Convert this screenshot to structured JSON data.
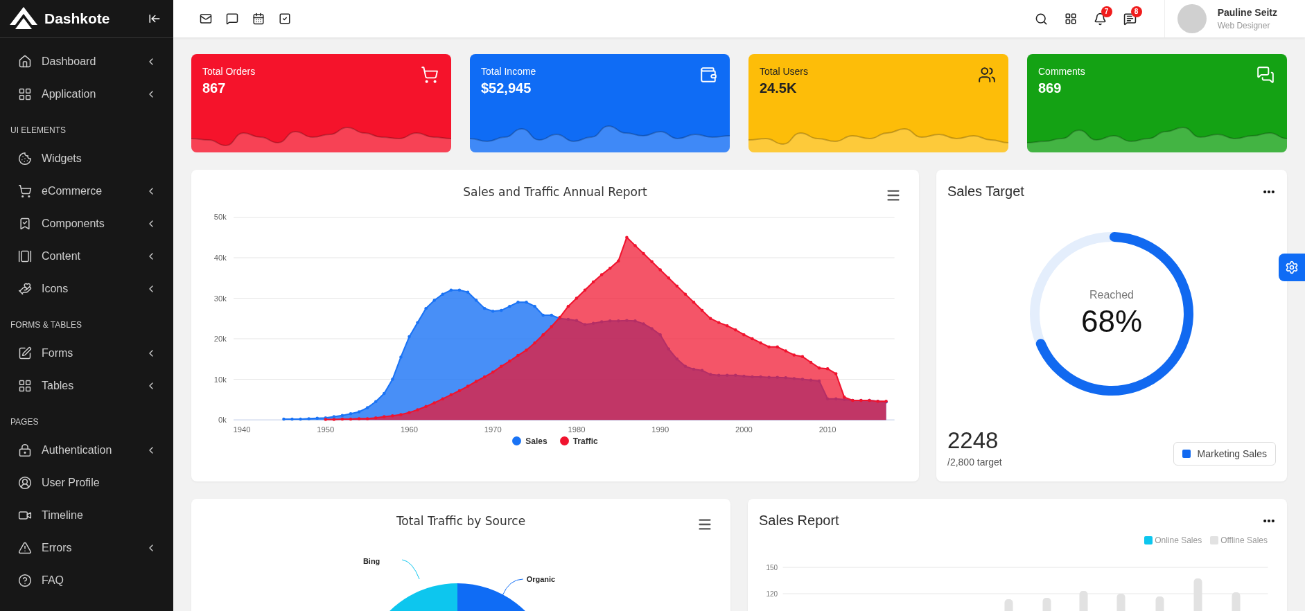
{
  "sidebar": {
    "brand": "Dashkote",
    "groups": [
      {
        "items": [
          {
            "label": "Dashboard",
            "has_submenu": true
          },
          {
            "label": "Application",
            "has_submenu": true
          }
        ]
      },
      {
        "heading": "UI ELEMENTS",
        "items": [
          {
            "label": "Widgets",
            "has_submenu": false
          },
          {
            "label": "eCommerce",
            "has_submenu": true
          },
          {
            "label": "Components",
            "has_submenu": true
          },
          {
            "label": "Content",
            "has_submenu": true
          },
          {
            "label": "Icons",
            "has_submenu": true
          }
        ]
      },
      {
        "heading": "FORMS & TABLES",
        "items": [
          {
            "label": "Forms",
            "has_submenu": true
          },
          {
            "label": "Tables",
            "has_submenu": true
          }
        ]
      },
      {
        "heading": "PAGES",
        "items": [
          {
            "label": "Authentication",
            "has_submenu": true
          },
          {
            "label": "User Profile",
            "has_submenu": false
          },
          {
            "label": "Timeline",
            "has_submenu": false
          },
          {
            "label": "Errors",
            "has_submenu": true
          },
          {
            "label": "FAQ",
            "has_submenu": false
          }
        ]
      }
    ]
  },
  "topbar": {
    "notification_count": "7",
    "message_count": "8",
    "user": {
      "name": "Pauline Seitz",
      "role": "Web Designer"
    }
  },
  "stats": [
    {
      "title": "Total Orders",
      "value": "867",
      "color": "#f5132b"
    },
    {
      "title": "Total Income",
      "value": "$52,945",
      "color": "#0f6cf5"
    },
    {
      "title": "Total Users",
      "value": "24.5K",
      "color": "#fdbd09"
    },
    {
      "title": "Comments",
      "value": "869",
      "color": "#14a214"
    }
  ],
  "annual_report": {
    "chart_data": {
      "type": "area",
      "title": "Sales and Traffic Annual Report",
      "x": [
        1945,
        1946,
        1947,
        1948,
        1949,
        1950,
        1951,
        1952,
        1953,
        1954,
        1955,
        1956,
        1957,
        1958,
        1959,
        1960,
        1961,
        1962,
        1963,
        1964,
        1965,
        1966,
        1967,
        1968,
        1969,
        1970,
        1971,
        1972,
        1973,
        1974,
        1975,
        1976,
        1977,
        1978,
        1979,
        1980,
        1981,
        1982,
        1983,
        1984,
        1985,
        1986,
        1987,
        1988,
        1989,
        1990,
        1991,
        1992,
        1993,
        1994,
        1995,
        1996,
        1997,
        1998,
        1999,
        2000,
        2001,
        2002,
        2003,
        2004,
        2005,
        2006,
        2007,
        2008,
        2009,
        2010,
        2011,
        2012,
        2013,
        2014,
        2015,
        2016,
        2017
      ],
      "series": [
        {
          "name": "Sales",
          "color": "#1a73f5",
          "values": [
            0.2,
            0.2,
            0.2,
            0.3,
            0.4,
            0.5,
            0.8,
            1.1,
            1.5,
            2,
            3,
            4.5,
            6.5,
            10,
            15.5,
            20.5,
            24,
            27.5,
            29.5,
            31,
            32,
            32,
            31.5,
            29.5,
            27.5,
            26.8,
            27,
            28,
            29,
            29,
            28,
            25.8,
            25.8,
            25,
            24.8,
            24.5,
            23.5,
            23.8,
            24.2,
            24.4,
            24.4,
            24.5,
            24.4,
            23.7,
            22.5,
            21,
            17.5,
            15,
            13.2,
            12.5,
            12.2,
            11.2,
            11,
            11,
            11,
            10.8,
            10.6,
            10.6,
            10.5,
            10.5,
            10.4,
            10.2,
            10,
            9.8,
            9.6,
            5.2,
            5.2,
            5,
            4.8,
            4.8,
            4.8,
            4.6,
            4.4
          ]
        },
        {
          "name": "Traffic",
          "color": "#f0132e",
          "values": [
            null,
            null,
            null,
            null,
            null,
            0.1,
            0.1,
            0.2,
            0.2,
            0.3,
            0.3,
            0.5,
            0.8,
            1,
            1.3,
            1.8,
            2.5,
            3.3,
            4.2,
            5.2,
            6.2,
            7.2,
            8.3,
            9.5,
            10.6,
            11.8,
            13.2,
            14.5,
            15.9,
            17.2,
            19,
            21,
            23,
            25.3,
            28,
            30,
            32,
            34,
            35.8,
            37.4,
            39.2,
            45,
            43,
            41,
            39,
            37,
            35,
            33,
            31,
            29,
            27,
            25,
            24,
            23.2,
            22.2,
            21,
            20,
            19,
            18,
            18,
            17,
            16,
            15.6,
            14.2,
            12.8,
            12.6,
            11.4,
            5.6,
            4.8,
            4.8,
            4.8,
            4.6,
            4.6
          ]
        }
      ],
      "grid": true,
      "xlim": [
        1939,
        2018
      ],
      "ylim": [
        0,
        50
      ],
      "xticks": [
        1940,
        1950,
        1960,
        1970,
        1980,
        1990,
        2000,
        2010
      ],
      "yticks": [
        {
          "value": 0,
          "label": "0k"
        },
        {
          "value": 10,
          "label": "10k"
        },
        {
          "value": 20,
          "label": "20k"
        },
        {
          "value": 30,
          "label": "30k"
        },
        {
          "value": 40,
          "label": "40k"
        },
        {
          "value": 50,
          "label": "50k"
        }
      ]
    }
  },
  "sales_target": {
    "title": "Sales Target",
    "center_label": "Reached",
    "center_value": "68%",
    "level": 0.68,
    "total": "2248",
    "target": "/2,800 target",
    "legend": "Marketing Sales"
  },
  "traffic_source": {
    "title": "Total Traffic by Source",
    "segments": [
      {
        "label": "Bing",
        "color": "#0dc6ee"
      },
      {
        "label": "Organic",
        "color": "#0f6cf5"
      }
    ]
  },
  "sales_report": {
    "title": "Sales Report",
    "legend": [
      {
        "label": "Online Sales",
        "color": "#0dc6ee"
      },
      {
        "label": "Offline Sales",
        "color": "#e2e2e2"
      }
    ],
    "y_labels": [
      "150",
      "120"
    ]
  }
}
